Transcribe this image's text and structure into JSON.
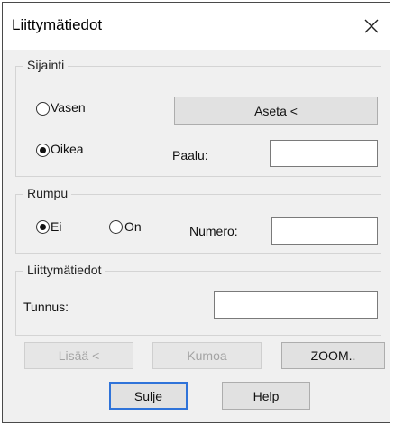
{
  "window": {
    "title": "Liittymätiedot",
    "close_icon": "close-icon"
  },
  "sijainti": {
    "label": "Sijainti",
    "radio_left_label": "Vasen",
    "radio_left_checked": false,
    "radio_right_label": "Oikea",
    "radio_right_checked": true,
    "set_button_label": "Aseta <",
    "paalu_label": "Paalu:",
    "paalu_value": ""
  },
  "rumpu": {
    "label": "Rumpu",
    "radio_no_label": "Ei",
    "radio_no_checked": true,
    "radio_yes_label": "On",
    "radio_yes_checked": false,
    "numero_label": "Numero:",
    "numero_value": ""
  },
  "liittymatiedot": {
    "label": "Liittymätiedot",
    "tunnus_label": "Tunnus:",
    "tunnus_value": ""
  },
  "buttons": {
    "add_label": "Lisää <",
    "add_enabled": false,
    "undo_label": "Kumoa",
    "undo_enabled": false,
    "zoom_label": "ZOOM..",
    "close_label": "Sulje",
    "help_label": "Help"
  }
}
